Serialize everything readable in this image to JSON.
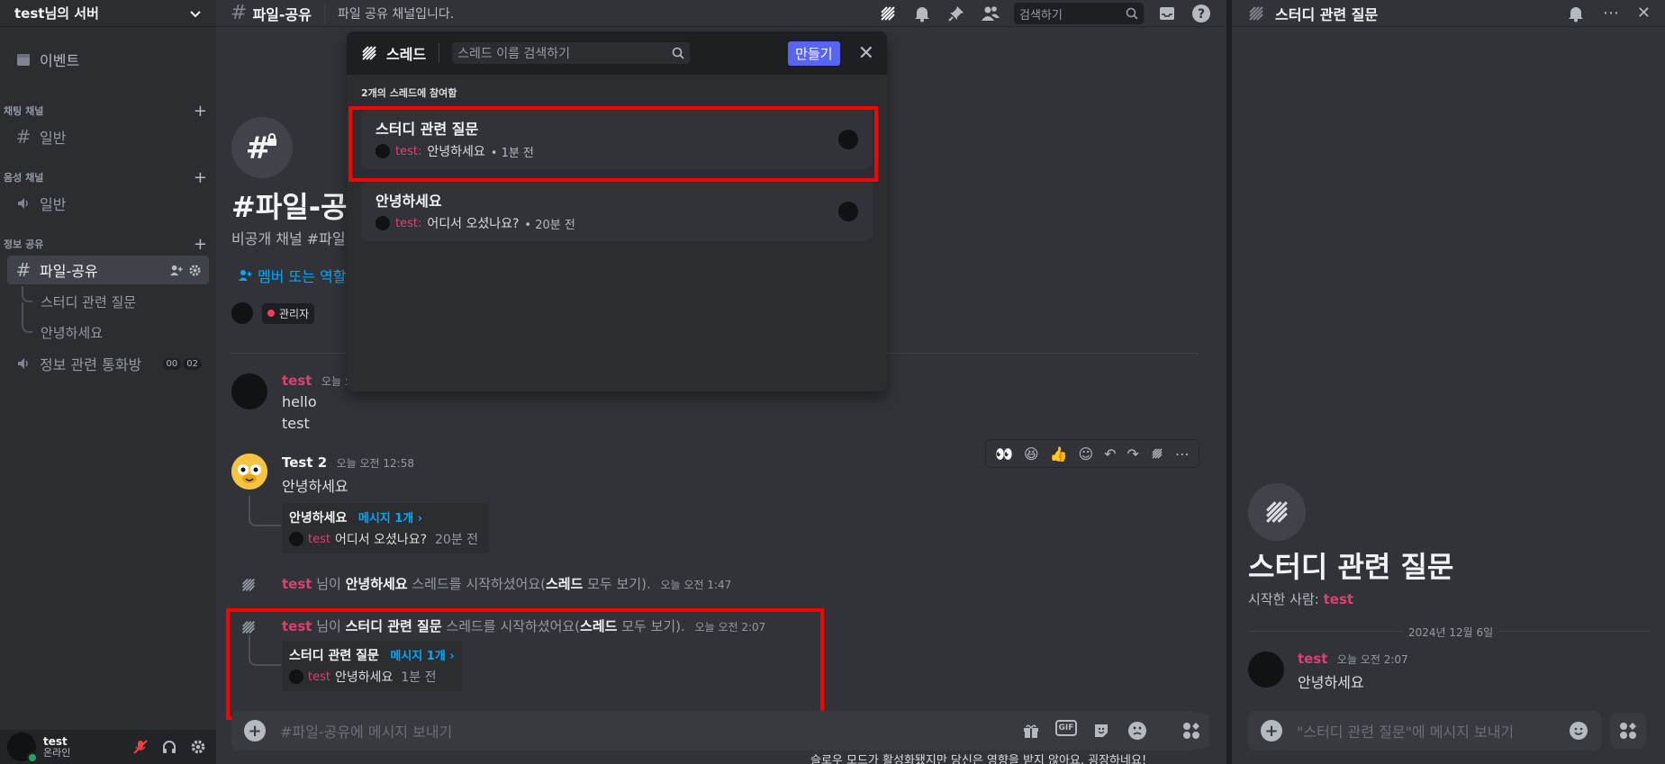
{
  "colors": {
    "accent": "#5865f2",
    "link": "#00a8fc",
    "username_pink": "#e03f6e",
    "highlight_box": "#ff0000"
  },
  "server": {
    "name": "test님의 서버"
  },
  "sidebar": {
    "event_label": "이벤트",
    "categories": [
      {
        "label": "채팅 채널",
        "channels": [
          {
            "label": "일반",
            "type": "text"
          }
        ]
      },
      {
        "label": "음성 채널",
        "channels": [
          {
            "label": "일반",
            "type": "voice"
          }
        ]
      },
      {
        "label": "정보 공유",
        "channels": [
          {
            "label": "파일-공유",
            "type": "text",
            "active": true
          },
          {
            "label": "스터디 관련 질문",
            "type": "thread"
          },
          {
            "label": "안녕하세요",
            "type": "thread"
          },
          {
            "label": "정보 관련 통화방",
            "type": "voice",
            "counts": [
              "00",
              "02"
            ]
          }
        ]
      }
    ]
  },
  "user": {
    "name": "test",
    "status": "온라인"
  },
  "topbar": {
    "channel": "파일-공유",
    "topic": "파일 공유 채널입니다.",
    "search_placeholder": "검색하기"
  },
  "welcome": {
    "title": "#파일-공",
    "subtitle": "비공개 채널 #파일",
    "add_members": "멤버 또는 역할",
    "role": "관리자"
  },
  "messages": [
    {
      "author": "test",
      "time": "오늘 오",
      "lines": [
        "hello",
        "test"
      ]
    },
    {
      "author": "Test 2",
      "time": "오늘 오전 12:58",
      "text": "안녕하세요",
      "thread": {
        "title": "안녕하세요",
        "count": "메시지 1개 ›",
        "preview_author": "test",
        "preview_text": "어디서 오셨나요?",
        "preview_time": "20분 전"
      }
    }
  ],
  "system_messages": [
    {
      "author": "test",
      "pre": " 님이 ",
      "thread": "안녕하세요",
      "post": " 스레드를 시작하셨어요(",
      "link": "스레드",
      "post2": " 모두 보기).",
      "time": "오늘 오전 1:47"
    },
    {
      "author": "test",
      "pre": " 님이 ",
      "thread": "스터디 관련 질문",
      "post": " 스레드를 시작하셨어요(",
      "link": "스레드",
      "post2": " 모두 보기).",
      "time": "오늘 오전 2:07",
      "card": {
        "title": "스터디 관련 질문",
        "count": "메시지 1개 ›",
        "preview_author": "test",
        "preview_text": "안녕하세요",
        "preview_time": "1분 전"
      }
    }
  ],
  "composer": {
    "placeholder": "#파일-공유에 메시지 보내기",
    "gif": "GIF"
  },
  "slowmode": "슬로우 모드가 활성화됐지만 당신은 영향을 받지 않아요. 굉장하네요!",
  "threads_popout": {
    "title": "스레드",
    "search_placeholder": "스레드 이름 검색하기",
    "create": "만들기",
    "section": "2개의 스레드에 참여함",
    "items": [
      {
        "title": "스터디 관련 질문",
        "author": "test:",
        "text": "안녕하세요",
        "time": "• 1분 전"
      },
      {
        "title": "안녕하세요",
        "author": "test:",
        "text": "어디서 오셨나요?",
        "time": "• 20분 전"
      }
    ]
  },
  "thread_panel": {
    "title": "스터디 관련 질문",
    "started_label": "시작한 사람:",
    "started_by": "test",
    "date": "2024년 12월 6일",
    "message": {
      "author": "test",
      "time": "오늘 오전 2:07",
      "text": "안녕하세요"
    },
    "composer_placeholder": "\"스터디 관련 질문\"에 메시지 보내기"
  }
}
